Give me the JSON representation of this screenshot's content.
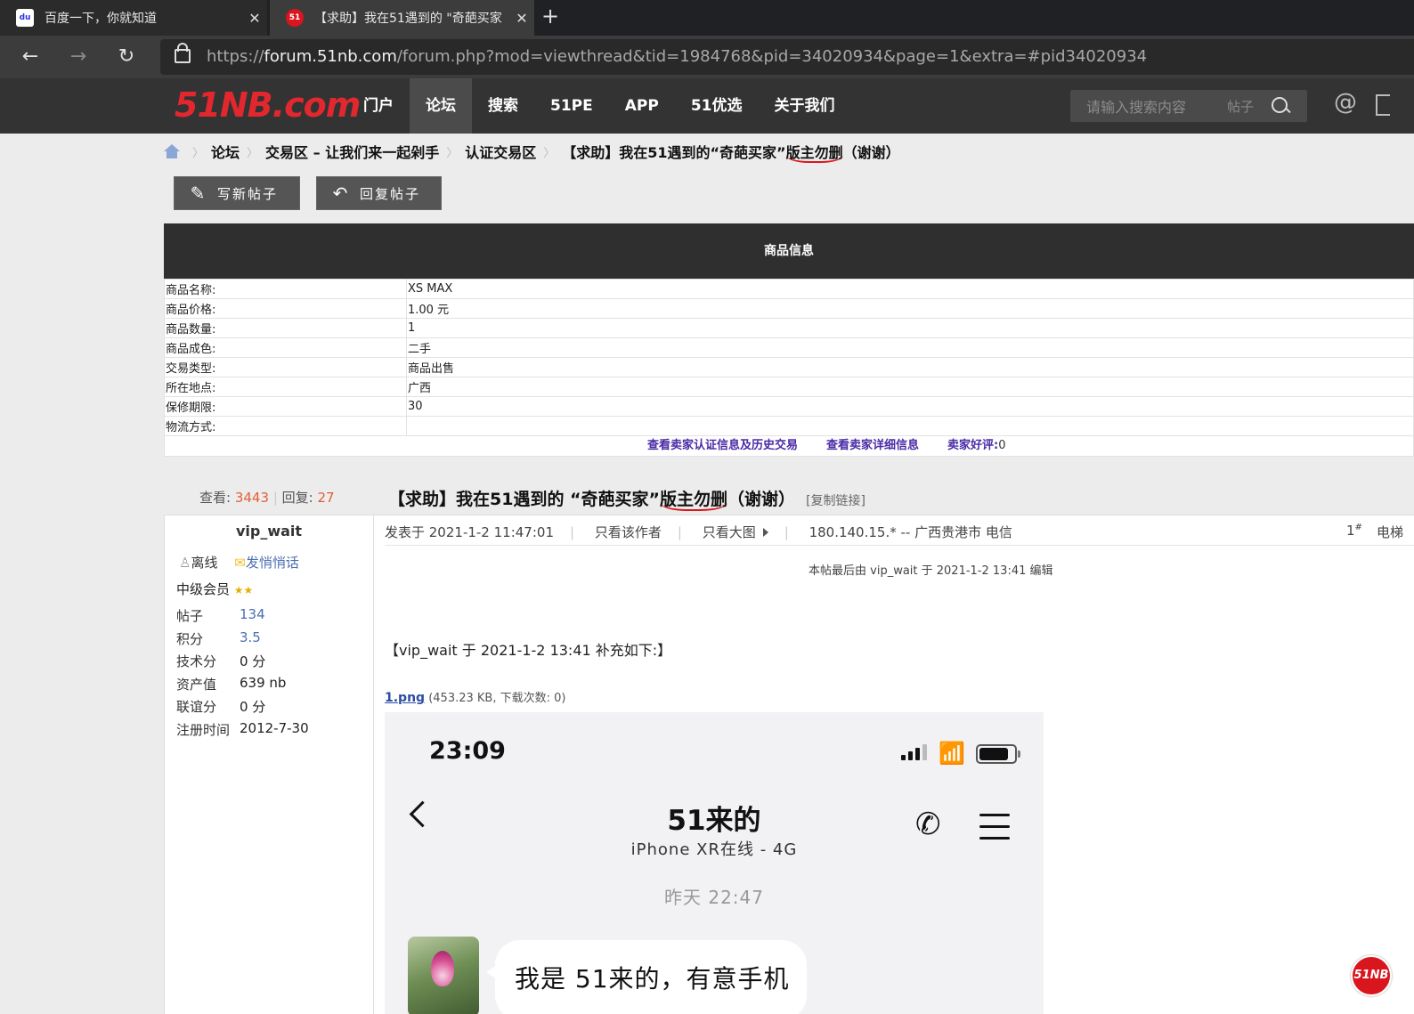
{
  "browser": {
    "tabs": [
      {
        "title": "百度一下，你就知道",
        "favicon": "baidu-paw-icon"
      },
      {
        "title": "【求助】我在51遇到的 \"奇葩买家",
        "favicon": "51nb-logo-icon",
        "active": true
      }
    ],
    "url_scheme": "https://",
    "url_host": "forum.51nb.com",
    "url_rest": "/forum.php?mod=viewthread&tid=1984768&pid=34020934&page=1&extra=#pid34020934"
  },
  "site": {
    "logo_a": "51NB",
    "logo_b": ".com",
    "nav": [
      "门户",
      "论坛",
      "搜索",
      "51PE",
      "APP",
      "51优选",
      "关于我们"
    ],
    "active_nav": "论坛",
    "search_placeholder": "请输入搜索内容",
    "search_scope": "帖子"
  },
  "breadcrumb": {
    "items": [
      "论坛",
      "交易区 – 让我们来一起剁手",
      "认证交易区"
    ],
    "current_a": "【求助】我在51遇到的“奇葩买家”",
    "current_u": "版主勿删",
    "current_b": "（谢谢）"
  },
  "actions": {
    "new_post": "写新帖子",
    "reply": "回复帖子"
  },
  "product": {
    "header": "商品信息",
    "rows": [
      {
        "k": "商品名称:",
        "v": "XS MAX"
      },
      {
        "k": "商品价格:",
        "v": "1.00 元"
      },
      {
        "k": "商品数量:",
        "v": "1"
      },
      {
        "k": "商品成色:",
        "v": "二手"
      },
      {
        "k": "交易类型:",
        "v": "商品出售"
      },
      {
        "k": "所在地点:",
        "v": "广西"
      },
      {
        "k": "保修期限:",
        "v": "30"
      },
      {
        "k": "物流方式:",
        "v": ""
      }
    ],
    "link_cert": "查看卖家认证信息及历史交易",
    "link_detail": "查看卖家详细信息",
    "rating_label": "卖家好评:",
    "rating_value": "0"
  },
  "thread": {
    "views_label": "查看:",
    "views": "3443",
    "replies_label": "回复:",
    "replies": "27",
    "title_a": "【求助】我在51遇到的 “奇葩买家”",
    "title_u": "版主勿删",
    "title_b": "（谢谢）",
    "copy_link": "[复制链接]"
  },
  "user": {
    "name": "vip_wait",
    "status": "离线",
    "pm": "发悄悄话",
    "group": "中级会员",
    "stats": [
      {
        "k": "帖子",
        "v": "134",
        "link": true
      },
      {
        "k": "积分",
        "v": "3.5",
        "link": true
      },
      {
        "k": "技术分",
        "v": "0 分",
        "link": false
      },
      {
        "k": "资产值",
        "v": "639 nb",
        "link": false
      },
      {
        "k": "联谊分",
        "v": "0 分",
        "link": false
      },
      {
        "k": "注册时间",
        "v": "2012-7-30",
        "link": false
      }
    ]
  },
  "post": {
    "posted": "发表于 2021-1-2 11:47:01",
    "author_only": "只看该作者",
    "big_image": "只看大图",
    "ip": "180.140.15.* -- 广西贵港市 电信",
    "floor": "1",
    "floor_sup": "#",
    "elevator": "电梯",
    "edited": "本帖最后由 vip_wait 于 2021-1-2 13:41 编辑",
    "supplement": "【vip_wait 于 2021-1-2 13:41 补充如下:】",
    "attach_name": "1.png",
    "attach_info": "(453.23 KB, 下载次数: 0)"
  },
  "screenshot": {
    "time": "23:09",
    "contact": "51来的",
    "subtitle": "iPhone XR在线 - 4G",
    "date": "昨天 22:47",
    "message": "我是 51来的，有意手机"
  },
  "fab_label": "51NB",
  "colors": {
    "accent_red": "#d9151d",
    "nav_bg": "#333333",
    "link_purple": "#4a2aa6",
    "count_orange": "#e0603a"
  }
}
